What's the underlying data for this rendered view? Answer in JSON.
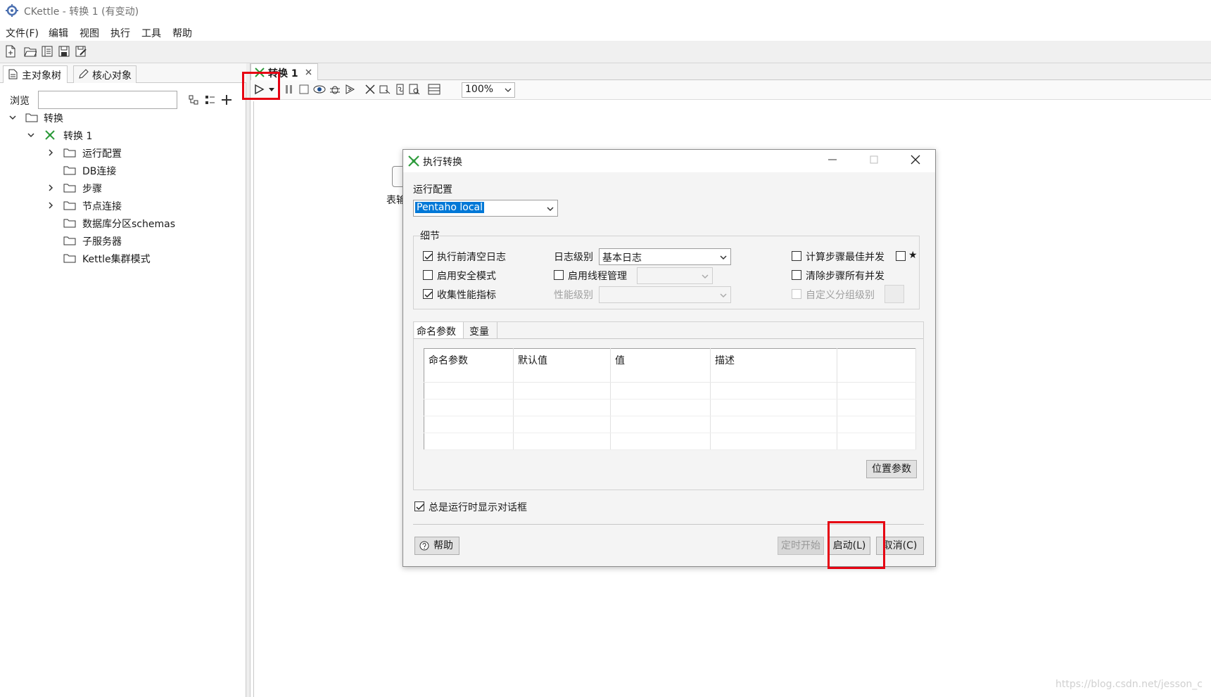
{
  "window": {
    "title": "CKettle - 转换 1 (有变动)"
  },
  "menu": [
    "文件(F)",
    "编辑",
    "视图",
    "执行",
    "工具",
    "帮助"
  ],
  "main_toolbar_icons": [
    "new-file-icon",
    "open-folder-icon",
    "explore-repository-icon",
    "save-icon",
    "save-as-icon"
  ],
  "left_panel": {
    "tabs": [
      {
        "label": "主对象树",
        "icon": "document-icon"
      },
      {
        "label": "核心对象",
        "icon": "pencil-icon"
      }
    ],
    "browse_label": "浏览",
    "browse_value": "",
    "tree": {
      "root": "转换",
      "transformation": "转换 1",
      "children": [
        "运行配置",
        "DB连接",
        "步骤",
        "节点连接",
        "数据库分区schemas",
        "子服务器",
        "Kettle集群模式"
      ]
    }
  },
  "editor": {
    "tab_label": "转换 1",
    "zoom": "100%",
    "canvas_partial_label": "表输"
  },
  "dialog": {
    "title": "执行转换",
    "run_config_label": "运行配置",
    "run_config_value": "Pentaho local",
    "details_label": "细节",
    "options": {
      "clear_log": {
        "label": "执行前清空日志",
        "checked": true
      },
      "safe_mode": {
        "label": "启用安全模式",
        "checked": false
      },
      "gather_metrics": {
        "label": "收集性能指标",
        "checked": true
      },
      "log_level_label": "日志级别",
      "log_level_value": "基本日志",
      "thread_mgmt": {
        "label": "启用线程管理",
        "checked": false
      },
      "perf_level_label": "性能级别",
      "calc_best_parallel": {
        "label": "计算步骤最佳并发",
        "checked": false
      },
      "clear_parallel": {
        "label": "清除步骤所有并发",
        "checked": false
      },
      "custom_group_level": {
        "label": "自定义分组级别",
        "checked": false
      },
      "star_label": "★"
    },
    "param_tabs": [
      "命名参数",
      "变量"
    ],
    "param_columns": [
      "命名参数",
      "默认值",
      "值",
      "描述"
    ],
    "position_params_button": "位置参数",
    "always_show_label": "总是运行时显示对话框",
    "always_show_checked": true,
    "help_button": "帮助",
    "schedule_button": "定时开始",
    "launch_button": "启动(L)",
    "cancel_button": "取消(C)"
  },
  "watermark": "https://blog.csdn.net/jesson_c",
  "colors": {
    "highlight_box": "#e60012",
    "selection": "#0078d7",
    "accent_green": "#2e9b3c"
  }
}
